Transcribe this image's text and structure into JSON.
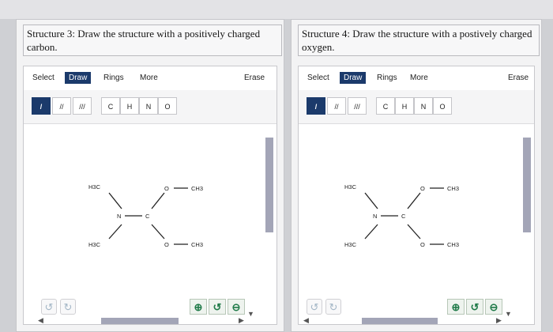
{
  "panels": [
    {
      "instruction": "Structure 3: Draw the structure with a positively charged carbon.",
      "tabs": [
        "Select",
        "Draw",
        "Rings",
        "More",
        "Erase"
      ],
      "bond_tools": [
        "/",
        "//",
        "///"
      ],
      "atom_tools": [
        "C",
        "H",
        "N",
        "O"
      ],
      "molecule": {
        "h3c_top": "H3C",
        "h3c_bottom": "H3C",
        "n": "N",
        "c": "C",
        "o_top": "O",
        "o_bottom": "O",
        "ch3_top": "CH3",
        "ch3_bottom": "CH3"
      }
    },
    {
      "instruction": "Structure 4: Draw the structure with a postively charged oxygen.",
      "tabs": [
        "Select",
        "Draw",
        "Rings",
        "More",
        "Erase"
      ],
      "bond_tools": [
        "/",
        "//",
        "///"
      ],
      "atom_tools": [
        "C",
        "H",
        "N",
        "O"
      ],
      "molecule": {
        "h3c_top": "H3C",
        "h3c_bottom": "H3C",
        "n": "N",
        "c": "C",
        "o_top": "O",
        "o_bottom": "O",
        "ch3_top": "CH3",
        "ch3_bottom": "CH3"
      }
    }
  ],
  "icons": {
    "undo": "undo-icon",
    "redo": "redo-icon",
    "zoom_in": "zoom-in-icon",
    "zoom_reset": "zoom-reset-icon",
    "zoom_out": "zoom-out-icon"
  },
  "colors": {
    "active_tab": "#1b3a6b",
    "scrollbar": "#a3a5b7",
    "zoom_icon": "#1f7a48"
  }
}
